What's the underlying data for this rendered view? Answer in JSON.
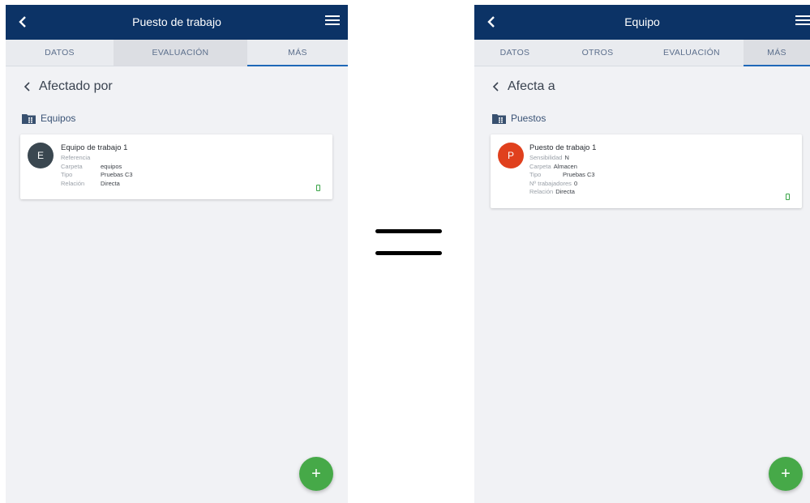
{
  "left": {
    "appbar_title": "Puesto de trabajo",
    "tabs": [
      {
        "label": "DATOS"
      },
      {
        "label": "EVALUACIÓN"
      },
      {
        "label": "MÁS"
      }
    ],
    "section_title": "Afectado por",
    "folder_label": "Equipos",
    "card": {
      "avatar_letter": "E",
      "avatar_color": "#3a4750",
      "title": "Equipo de trabajo 1",
      "fields": [
        {
          "label": "Referencia",
          "value": ""
        },
        {
          "label": "Carpeta",
          "value": "equipos"
        },
        {
          "label": "Tipo",
          "value": "Pruebas C3"
        },
        {
          "label": "Relación",
          "value": "Directa"
        }
      ]
    },
    "fab_label": "+"
  },
  "right": {
    "appbar_title": "Equipo",
    "tabs": [
      {
        "label": "DATOS"
      },
      {
        "label": "OTROS"
      },
      {
        "label": "EVALUACIÓN"
      },
      {
        "label": "MÁS"
      }
    ],
    "section_title": "Afecta a",
    "folder_label": "Puestos",
    "card": {
      "avatar_letter": "P",
      "avatar_color": "#e0401d",
      "title": "Puesto de trabajo 1",
      "fields": [
        {
          "label": "Sensibilidad",
          "value": "N"
        },
        {
          "label": "Carpeta",
          "value": "Almacen"
        },
        {
          "label": "Tipo",
          "value": "Pruebas C3"
        },
        {
          "label": "Nº trabajadores",
          "value": "0"
        },
        {
          "label": "Relación",
          "value": "Directa"
        }
      ]
    },
    "fab_label": "+"
  },
  "colors": {
    "appbar": "#0c3366",
    "fab": "#46a948",
    "active_tab_underline": "#1f68b8",
    "background": "#f1f2f5"
  },
  "icons": {
    "back": "chevron-left-icon",
    "menu": "hamburger-menu-icon",
    "folder": "folder-icon",
    "status": "status-indicator-icon",
    "fab": "plus-icon"
  }
}
